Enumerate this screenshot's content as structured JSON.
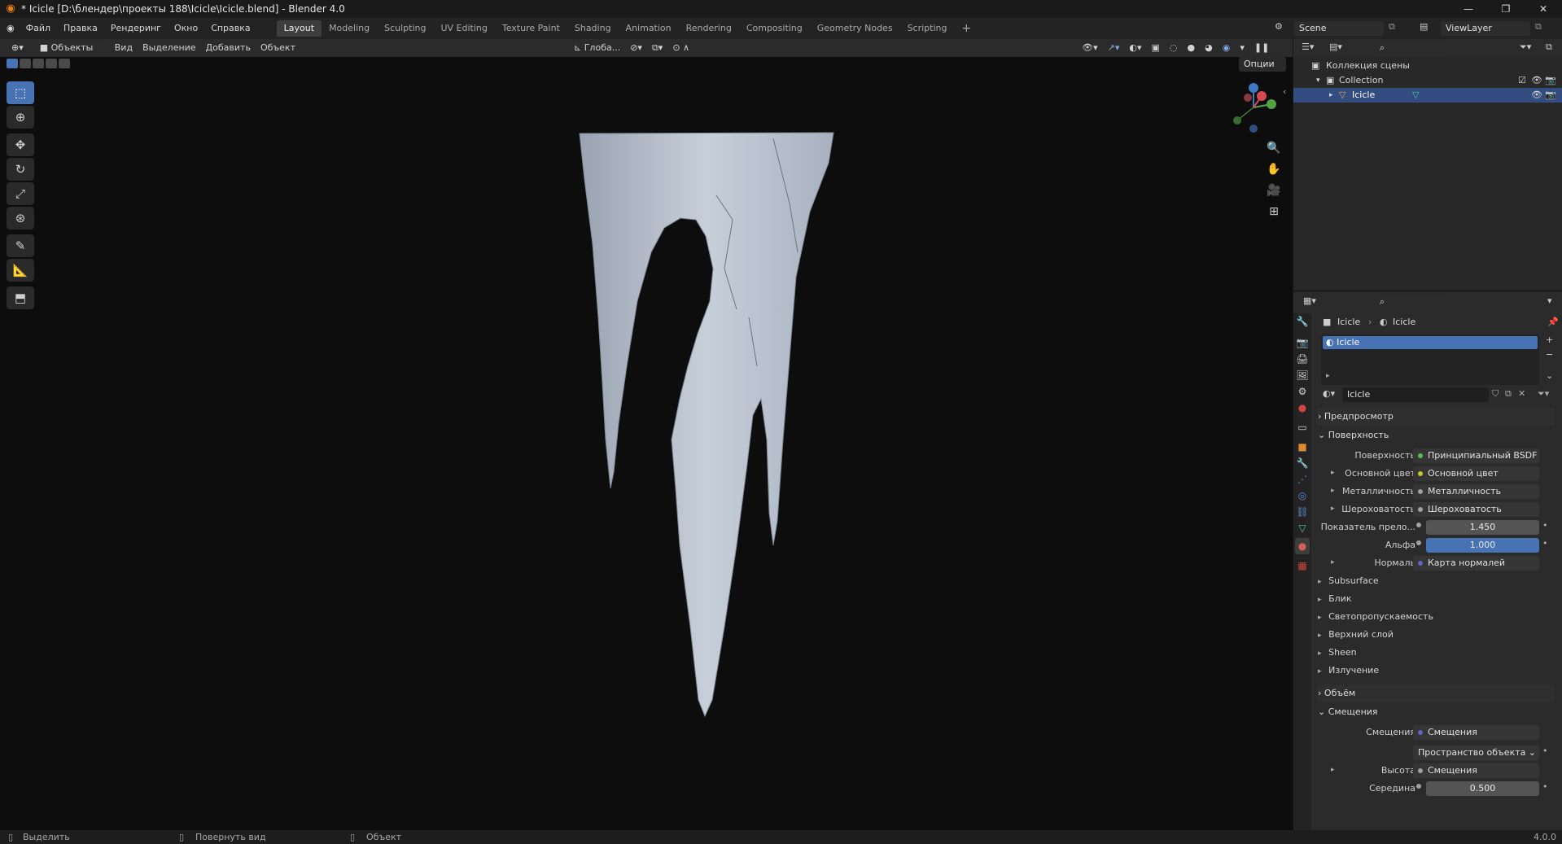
{
  "title": "* Icicle [D:\\блендер\\проекты 188\\Icicle\\Icicle.blend] - Blender 4.0",
  "menu": [
    "Файл",
    "Правка",
    "Рендеринг",
    "Окно",
    "Справка"
  ],
  "workspaces": [
    "Layout",
    "Modeling",
    "Sculpting",
    "UV Editing",
    "Texture Paint",
    "Shading",
    "Animation",
    "Rendering",
    "Compositing",
    "Geometry Nodes",
    "Scripting"
  ],
  "active_workspace": "Layout",
  "scene": "Scene",
  "view_layer": "ViewLayer",
  "viewport_header": {
    "mode": "Объекты",
    "view": "Вид",
    "select": "Выделение",
    "add": "Добавить",
    "object": "Объект",
    "orientation": "Глоба...",
    "options": "Опции"
  },
  "outliner": {
    "scene_collection": "Коллекция сцены",
    "collection": "Collection",
    "object": "Icicle"
  },
  "properties": {
    "breadcrumb_object": "Icicle",
    "breadcrumb_material": "Icicle",
    "material_slot": "Icicle",
    "material_name": "Icicle",
    "preview": "Предпросмотр",
    "surface_panel": "Поверхность",
    "surface_label": "Поверхность",
    "surface_value": "Принципиальный BSDF",
    "base_color_label": "Основной цвет",
    "base_color_value": "Основной цвет",
    "metallic_label": "Металличность",
    "metallic_value": "Металличность",
    "roughness_label": "Шероховатость",
    "roughness_value": "Шероховатость",
    "ior_label": "Показатель прело...",
    "ior_value": "1.450",
    "alpha_label": "Альфа",
    "alpha_value": "1.000",
    "normal_label": "Нормаль",
    "normal_value": "Карта нормалей",
    "subsections": [
      "Subsurface",
      "Блик",
      "Светопропускаемость",
      "Верхний слой",
      "Sheen",
      "Излучение"
    ],
    "volume_panel": "Объём",
    "displacement_panel": "Смещения",
    "disp_label": "Смещения",
    "disp_value": "Смещения",
    "space_value": "Пространство объекта",
    "height_label": "Высота",
    "height_value": "Смещения",
    "midlevel_label": "Середина",
    "midlevel_value": "0.500"
  },
  "status": {
    "select": "Выделить",
    "rotate": "Повернуть вид",
    "object": "Объект",
    "version": "4.0.0"
  },
  "colors": {
    "accent": "#4772b3",
    "viewport_bg": "#0d0d0d",
    "icicle": "#b9c2cf"
  }
}
